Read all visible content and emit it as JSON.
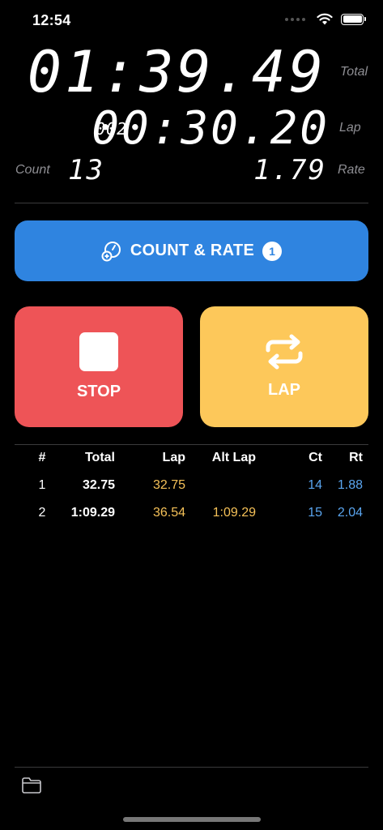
{
  "status": {
    "time": "12:54"
  },
  "display": {
    "total_time": "01:39.49",
    "total_label": "Total",
    "lap_index": "002",
    "lap_time": "00:30.20",
    "lap_label": "Lap",
    "count_label": "Count",
    "count_value": "13",
    "rate_value": "1.79",
    "rate_label": "Rate"
  },
  "buttons": {
    "count_rate_label": "COUNT & RATE",
    "count_rate_badge": "1",
    "stop_label": "STOP",
    "lap_label": "LAP"
  },
  "table": {
    "headers": {
      "num": "#",
      "total": "Total",
      "lap": "Lap",
      "alt_lap": "Alt Lap",
      "ct": "Ct",
      "rt": "Rt"
    },
    "rows": [
      {
        "num": "1",
        "total": "32.75",
        "lap": "32.75",
        "alt_lap": "",
        "ct": "14",
        "rt": "1.88"
      },
      {
        "num": "2",
        "total": "1:09.29",
        "lap": "36.54",
        "alt_lap": "1:09.29",
        "ct": "15",
        "rt": "2.04"
      }
    ]
  },
  "icons": {
    "wifi": "wifi-icon",
    "battery": "battery-icon",
    "count_rate": "gauge-plus-icon",
    "stop": "stop-square-icon",
    "lap": "repeat-arrows-icon",
    "folder": "folder-icon"
  },
  "colors": {
    "count_rate_button": "#2f84e0",
    "stop_button": "#ee5457",
    "lap_button": "#fdc85a",
    "lap_value": "#f5c158",
    "count_value": "#5aa5ef"
  }
}
